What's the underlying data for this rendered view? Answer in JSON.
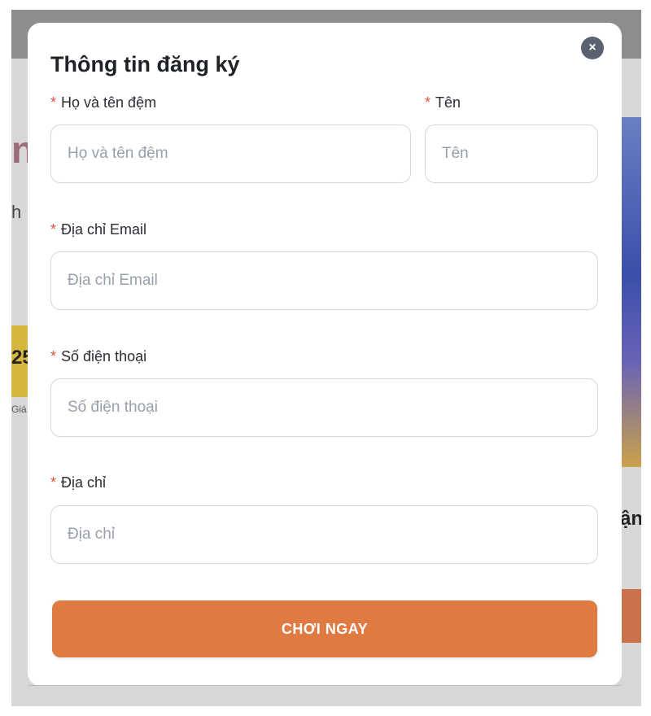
{
  "modal": {
    "title": "Thông tin đăng ký",
    "close_icon": "close-icon",
    "close_glyph": "×"
  },
  "form": {
    "required_mark": "*",
    "fields": [
      {
        "name": "ho_va_ten_dem",
        "label": "Họ và tên đệm",
        "placeholder": "Họ và tên đệm",
        "value": ""
      },
      {
        "name": "ten",
        "label": "Tên",
        "placeholder": "Tên",
        "value": ""
      },
      {
        "name": "email",
        "label": "Địa chỉ Email",
        "placeholder": "Địa chỉ Email",
        "value": ""
      },
      {
        "name": "phone",
        "label": "Số điện thoại",
        "placeholder": "Số điện thoại",
        "value": ""
      },
      {
        "name": "address",
        "label": "Địa chỉ",
        "placeholder": "Địa chỉ",
        "value": ""
      }
    ],
    "submit_label": "CHƠI NGAY"
  },
  "background": {
    "left_fragment_1": "n",
    "left_fragment_2": "h",
    "left_price_fragment": "25",
    "left_caption_fragment": "Giá",
    "right_fragment": "ận"
  },
  "colors": {
    "accent": "#e07a43",
    "required": "#e0533a",
    "close_button": "#5c6170",
    "overlay": "#8d8d8f"
  }
}
